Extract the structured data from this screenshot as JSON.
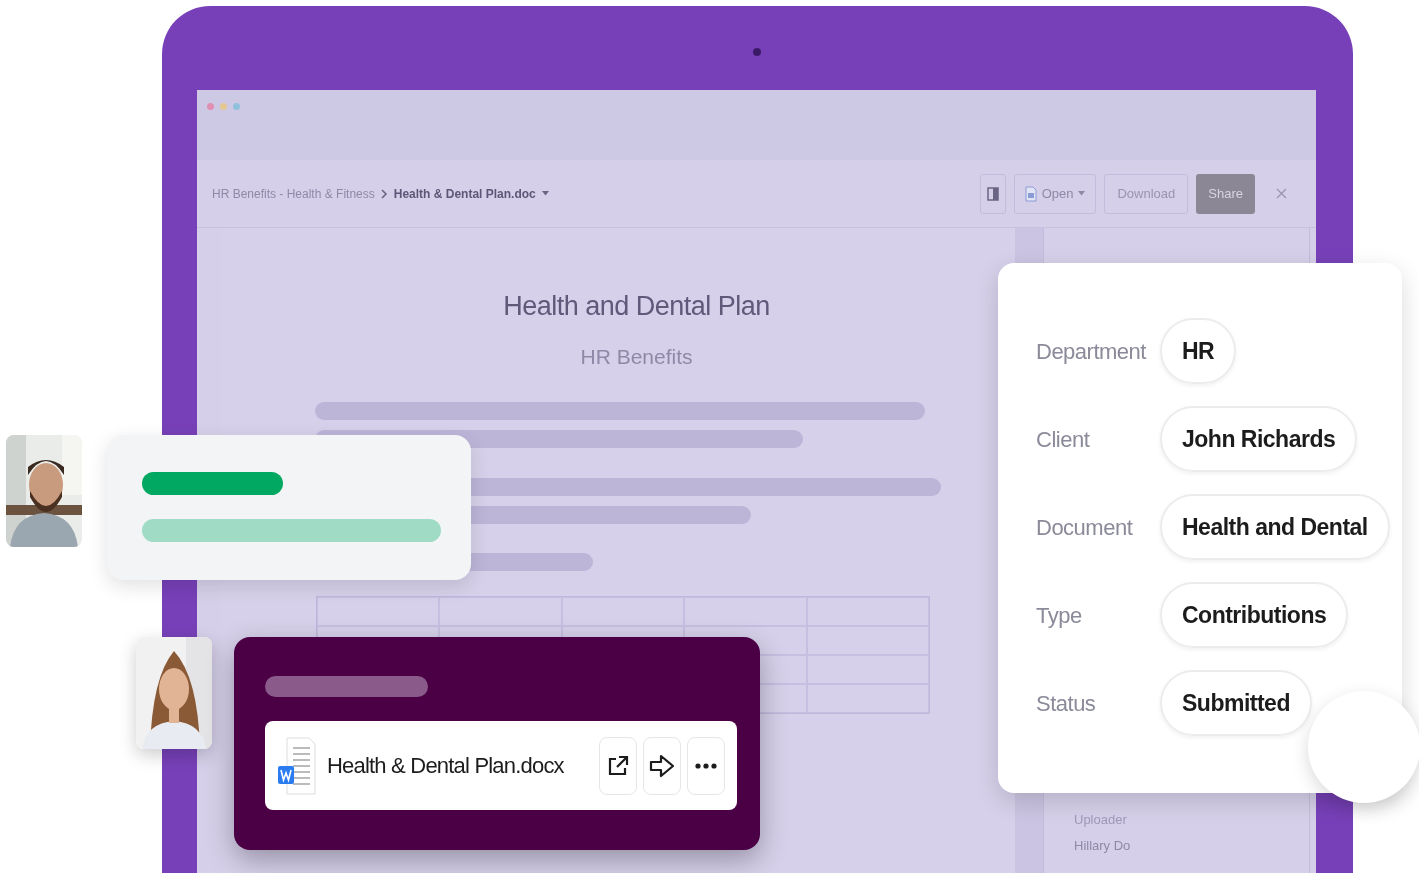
{
  "breadcrumb": {
    "path": "HR Benefits - Health & Fitness",
    "current": "Health & Dental Plan.doc"
  },
  "toolbar": {
    "buttons": [
      {
        "kind": "panel"
      },
      {
        "kind": "open",
        "label": "Open"
      },
      {
        "kind": "plain",
        "label": "Download"
      },
      {
        "kind": "primary",
        "label": "Share"
      },
      {
        "kind": "close"
      }
    ]
  },
  "document": {
    "title": "Health and Dental Plan",
    "subtitle": "HR Benefits"
  },
  "sidebar": {
    "label": "Uploader",
    "value": "Hillary Do"
  },
  "details": [
    {
      "label": "Department",
      "value": "HR"
    },
    {
      "label": "Client",
      "value": "John Richards"
    },
    {
      "label": "Document",
      "value": "Health and Dental"
    },
    {
      "label": "Type",
      "value": "Contributions"
    },
    {
      "label": "Status",
      "value": "Submitted"
    }
  ],
  "file_card": {
    "file_name": "Health & Dental Plan.docx",
    "actions": [
      {
        "kind": "open_external"
      },
      {
        "kind": "share"
      },
      {
        "kind": "more"
      }
    ]
  }
}
